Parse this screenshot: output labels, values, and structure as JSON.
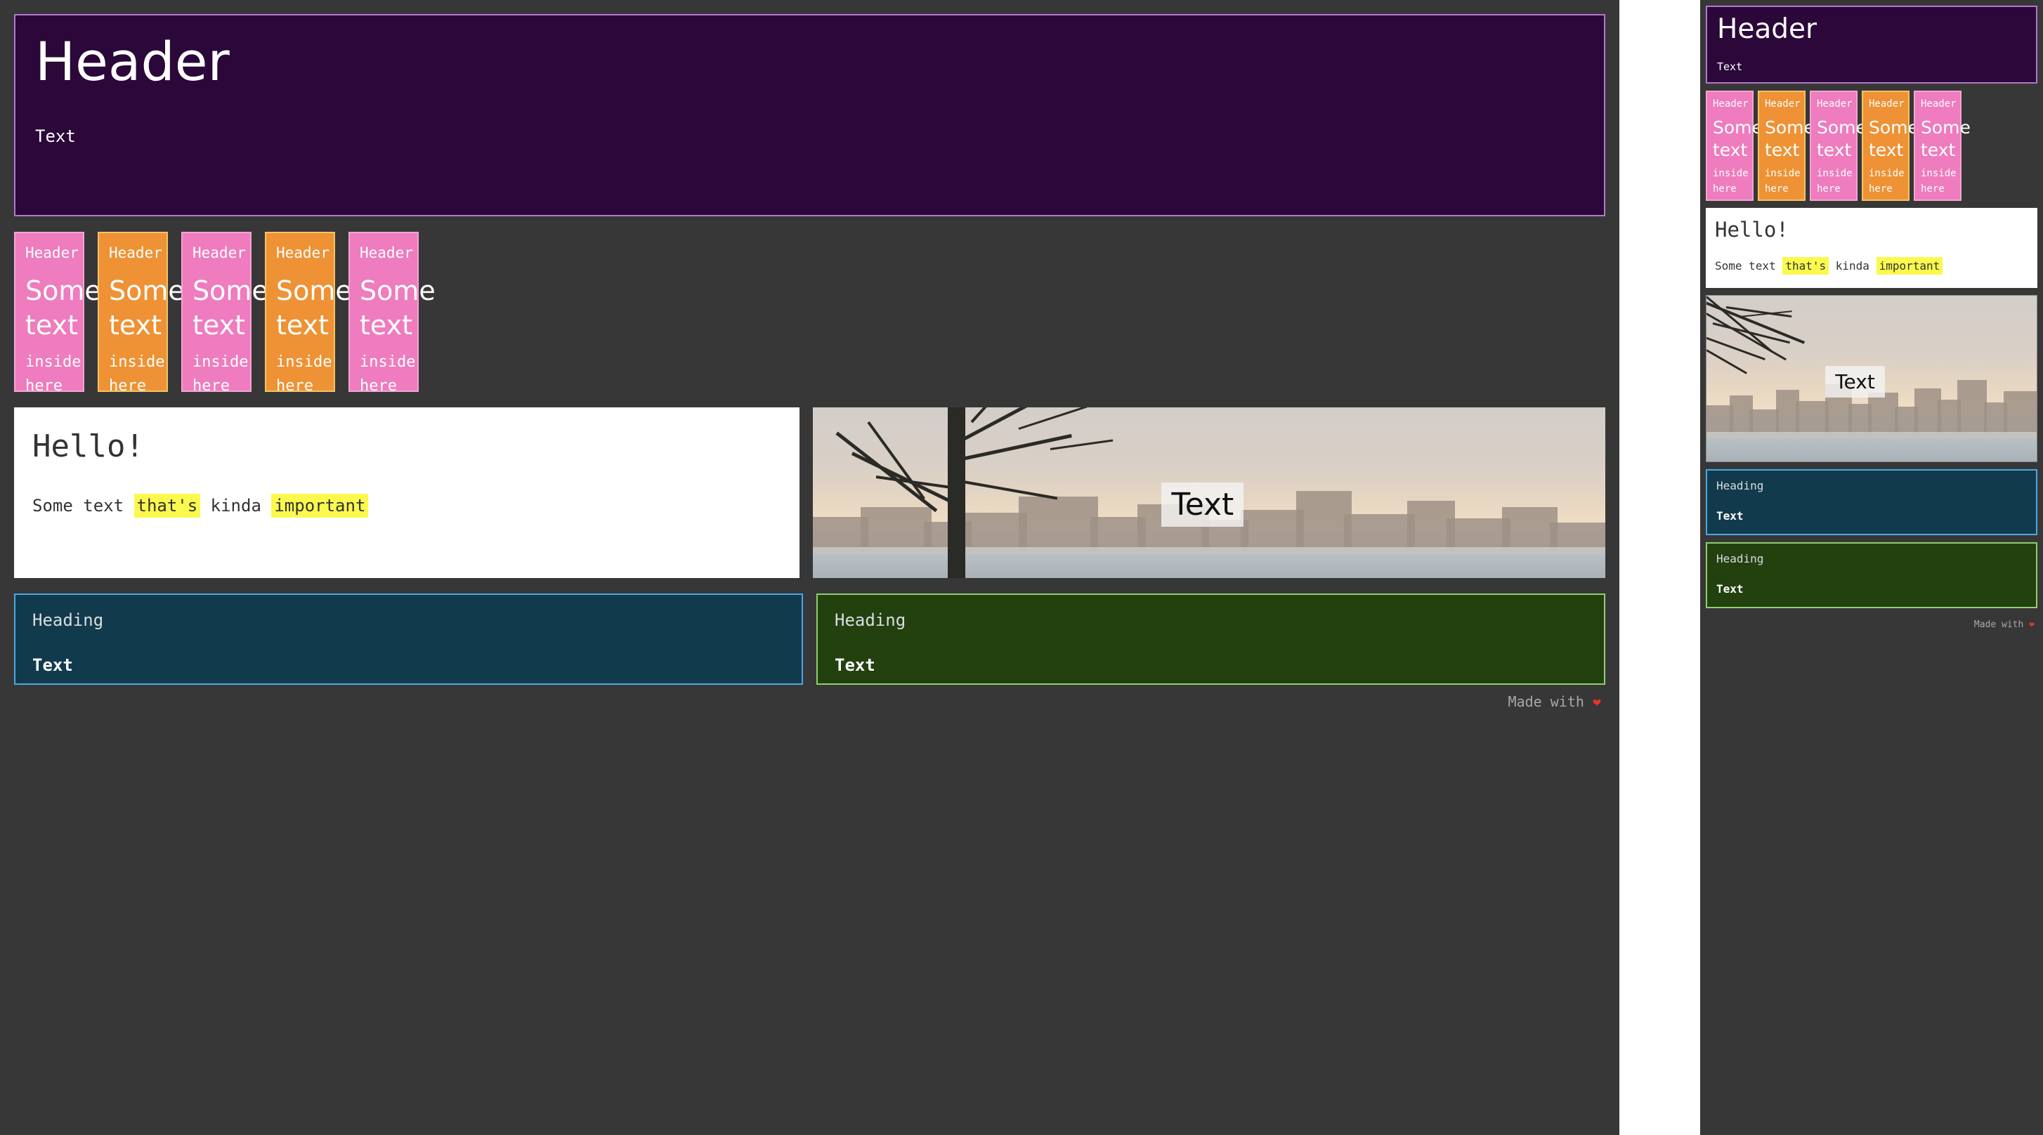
{
  "colors": {
    "page_background": "#373737",
    "hero_background": "#2b073a",
    "hero_border": "#b279c9",
    "card_pink": "#ee7cbe",
    "card_pink_border": "#f3a5d3",
    "card_orange": "#ee9235",
    "card_orange_border": "#f5c463",
    "highlight_yellow": "#fbf94d",
    "teal_background": "#123a4d",
    "teal_border": "#4aa8e8",
    "green_background": "#23400f",
    "green_border": "#8fd070",
    "hello_background": "#ffffff",
    "heart_red": "#e8342a"
  },
  "hero": {
    "title": "Header",
    "text": "Text"
  },
  "mini_cards": [
    {
      "head": "Header",
      "body": "Some text",
      "tail": "inside here",
      "variant": "pink"
    },
    {
      "head": "Header",
      "body": "Some text",
      "tail": "inside here",
      "variant": "orange"
    },
    {
      "head": "Header",
      "body": "Some text",
      "tail": "inside here",
      "variant": "pink"
    },
    {
      "head": "Header",
      "body": "Some text",
      "tail": "inside here",
      "variant": "orange"
    },
    {
      "head": "Header",
      "body": "Some text",
      "tail": "inside here",
      "variant": "pink"
    }
  ],
  "hello_card": {
    "title": "Hello!",
    "para_part1": "Some text ",
    "para_mark1": "that's",
    "para_part2": " kinda ",
    "para_mark2": "important"
  },
  "photo_card": {
    "overlay_text": "Text",
    "description": "City skyline at sunset seen through a bare winter tree across water"
  },
  "bottom_boxes": [
    {
      "head": "Heading",
      "text": "Text",
      "variant": "teal"
    },
    {
      "head": "Heading",
      "text": "Text",
      "variant": "green"
    }
  ],
  "footer": {
    "text": "Made with",
    "heart": "❤"
  }
}
